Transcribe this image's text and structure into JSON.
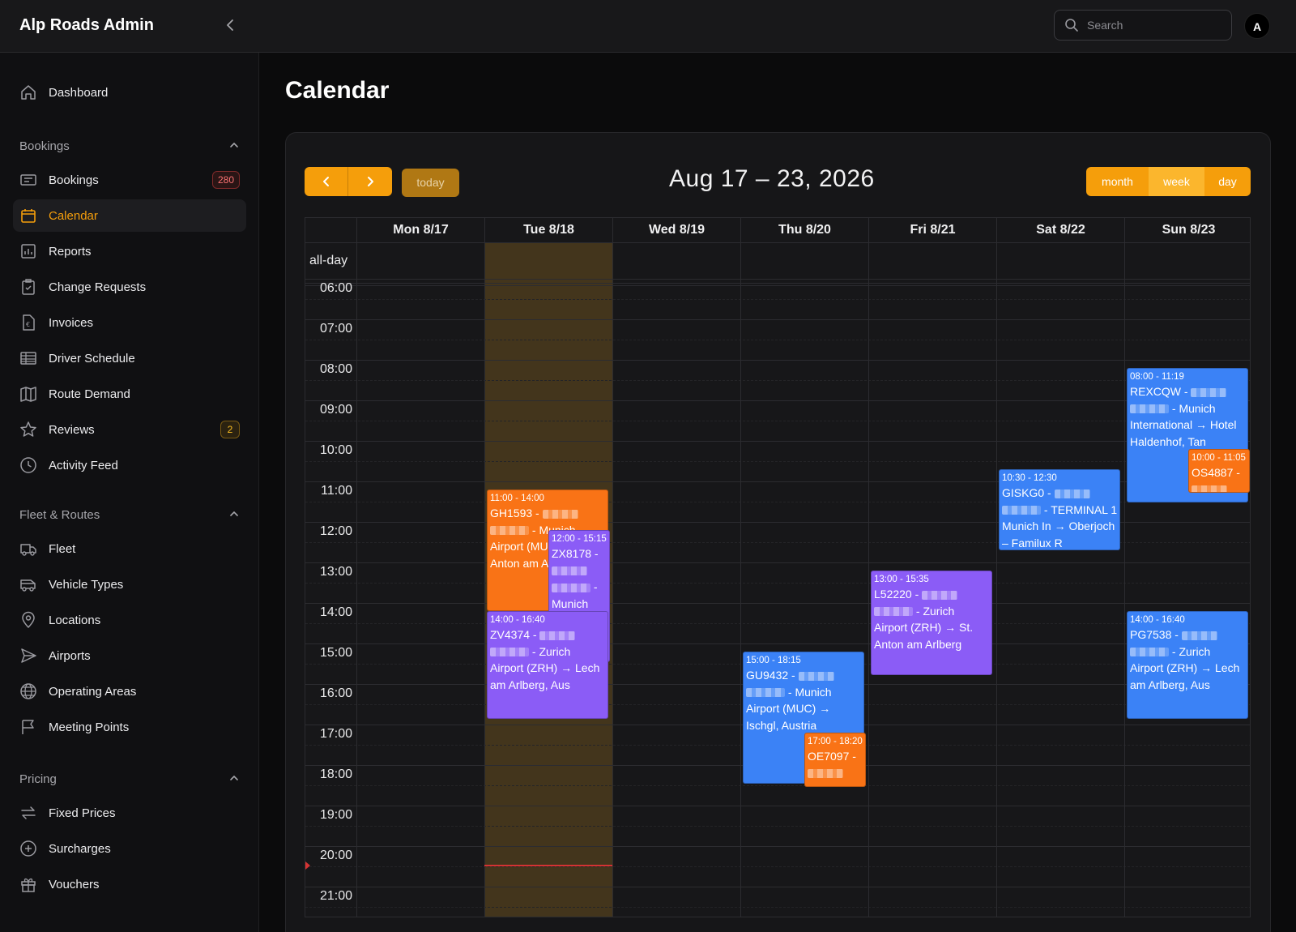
{
  "app": {
    "title": "Alp Roads Admin",
    "collapse_icon": "chevron-left-icon"
  },
  "search": {
    "placeholder": "Search"
  },
  "user": {
    "avatar_initial": "A"
  },
  "sidebar": {
    "top": [
      {
        "label": "Dashboard",
        "icon": "home-icon"
      }
    ],
    "groups": [
      {
        "label": "Bookings",
        "items": [
          {
            "label": "Bookings",
            "icon": "ticket-icon",
            "badge": "280"
          },
          {
            "label": "Calendar",
            "icon": "calendar-icon",
            "active": true
          },
          {
            "label": "Reports",
            "icon": "bar-chart-icon"
          },
          {
            "label": "Change Requests",
            "icon": "clipboard-check-icon"
          },
          {
            "label": "Invoices",
            "icon": "euro-document-icon"
          },
          {
            "label": "Driver Schedule",
            "icon": "table-icon"
          },
          {
            "label": "Route Demand",
            "icon": "map-icon"
          },
          {
            "label": "Reviews",
            "icon": "star-icon",
            "badge": "2"
          },
          {
            "label": "Activity Feed",
            "icon": "clock-icon"
          }
        ]
      },
      {
        "label": "Fleet & Routes",
        "items": [
          {
            "label": "Fleet",
            "icon": "truck-icon"
          },
          {
            "label": "Vehicle Types",
            "icon": "van-icon"
          },
          {
            "label": "Locations",
            "icon": "map-pin-icon"
          },
          {
            "label": "Airports",
            "icon": "paper-plane-icon"
          },
          {
            "label": "Operating Areas",
            "icon": "globe-icon"
          },
          {
            "label": "Meeting Points",
            "icon": "flag-icon"
          }
        ]
      },
      {
        "label": "Pricing",
        "items": [
          {
            "label": "Fixed Prices",
            "icon": "arrows-swap-icon"
          },
          {
            "label": "Surcharges",
            "icon": "plus-circle-icon"
          },
          {
            "label": "Vouchers",
            "icon": "gift-icon"
          }
        ]
      }
    ]
  },
  "page": {
    "title": "Calendar"
  },
  "toolbar": {
    "prev": "‹",
    "next": "›",
    "today": "today",
    "range": "Aug 17 – 23, 2026",
    "views": [
      "month",
      "week",
      "day"
    ],
    "active_view": "week"
  },
  "calendar": {
    "allday_label": "all-day",
    "days": [
      "Mon 8/17",
      "Tue 8/18",
      "Wed 8/19",
      "Thu 8/20",
      "Fri 8/21",
      "Sat 8/22",
      "Sun 8/23"
    ],
    "today_index": 1,
    "hours": [
      "06:00",
      "07:00",
      "08:00",
      "09:00",
      "10:00",
      "11:00",
      "12:00",
      "13:00",
      "14:00",
      "15:00",
      "16:00",
      "17:00",
      "18:00",
      "19:00",
      "20:00",
      "21:00"
    ],
    "now_time": "20:15",
    "events": [
      {
        "day": 1,
        "start": "11:00",
        "end": "14:00",
        "color": "orange",
        "time": "11:00 - 14:00",
        "code": "GH1593 -",
        "text": "- Munich Airport (MUC) → St. Anton am Arlberg"
      },
      {
        "day": 1,
        "start": "12:00",
        "end": "15:15",
        "color": "purple",
        "indent": true,
        "time": "12:00 - 15:15",
        "code": "ZX8178 -",
        "text": "- Munich Airport (MUC) → Ischgl,"
      },
      {
        "day": 1,
        "start": "14:00",
        "end": "16:40",
        "color": "purple",
        "time": "14:00 - 16:40",
        "code": "ZV4374 -",
        "text": "- Zurich Airport (ZRH) → Lech am Arlberg, Aus"
      },
      {
        "day": 3,
        "start": "15:00",
        "end": "18:15",
        "color": "blue",
        "time": "15:00 - 18:15",
        "code": "GU9432 -",
        "text": "- Munich Airport (MUC) → Ischgl, Austria"
      },
      {
        "day": 3,
        "start": "17:00",
        "end": "18:20",
        "color": "orange",
        "indent": true,
        "time": "17:00 - 18:20",
        "code": "OE7097 -",
        "text": ""
      },
      {
        "day": 4,
        "start": "13:00",
        "end": "15:35",
        "color": "purple",
        "time": "13:00 - 15:35",
        "code": "L52220 -",
        "text": "- Zurich Airport (ZRH) → St. Anton am Arlberg"
      },
      {
        "day": 5,
        "start": "10:30",
        "end": "12:30",
        "color": "blue",
        "time": "10:30 - 12:30",
        "code": "GISKG0 -",
        "text": "- TERMINAL 1 Munich In → Oberjoch – Familux R"
      },
      {
        "day": 6,
        "start": "08:00",
        "end": "11:19",
        "color": "blue",
        "time": "08:00 - 11:19",
        "code": "REXCQW -",
        "text": "- Munich International → Hotel Haldenhof, Tan"
      },
      {
        "day": 6,
        "start": "10:00",
        "end": "11:05",
        "color": "orange",
        "indent": true,
        "time": "10:00 - 11:05",
        "code": "OS4887 -",
        "text": ""
      },
      {
        "day": 6,
        "start": "14:00",
        "end": "16:40",
        "color": "blue",
        "time": "14:00 - 16:40",
        "code": "PG7538 -",
        "text": "- Zurich Airport (ZRH) → Lech am Arlberg, Aus"
      }
    ]
  }
}
